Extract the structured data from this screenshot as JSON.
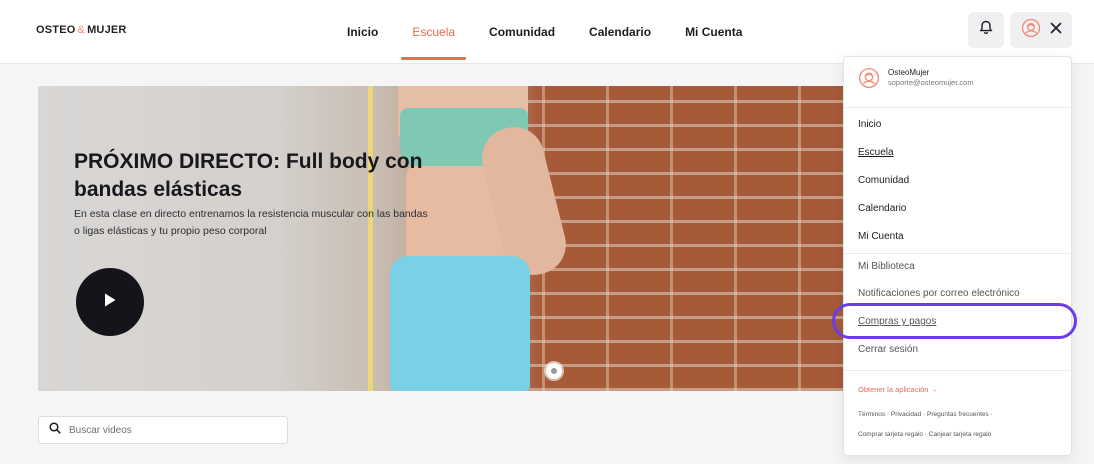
{
  "header": {
    "logo_left": "OSTEO",
    "logo_amp": "&",
    "logo_right": "MUJER",
    "nav": [
      {
        "label": "Inicio"
      },
      {
        "label": "Escuela"
      },
      {
        "label": "Comunidad"
      },
      {
        "label": "Calendario"
      },
      {
        "label": "Mi Cuenta"
      }
    ],
    "active_nav": "Escuela"
  },
  "hero": {
    "title": "PRÓXIMO DIRECTO: Full body con bandas elásticas",
    "description": "En esta clase en directo entrenamos la resistencia muscular con las bandas o ligas elásticas y tu propio peso corporal"
  },
  "search": {
    "placeholder": "Buscar videos"
  },
  "dropdown": {
    "user_name": "OsteoMujer",
    "user_email": "soporte@osteomujer.com",
    "main_items": [
      "Inicio",
      "Escuela",
      "Comunidad",
      "Calendario",
      "Mi Cuenta"
    ],
    "account_items": [
      "Mi Biblioteca",
      "Notificaciones por correo electrónico",
      "Compras y pagos",
      "Cerrar sesión"
    ],
    "app_link": "Obtener la aplicación →",
    "footer_line1": "Términos · Privacidad · Preguntas frecuentes ·",
    "footer_line2": "Comprar tarjeta regalo · Canjear tarjeta regalo"
  },
  "colors": {
    "accent": "#e86a4f",
    "highlight": "#6a3de8",
    "play_button": "#14141a"
  }
}
